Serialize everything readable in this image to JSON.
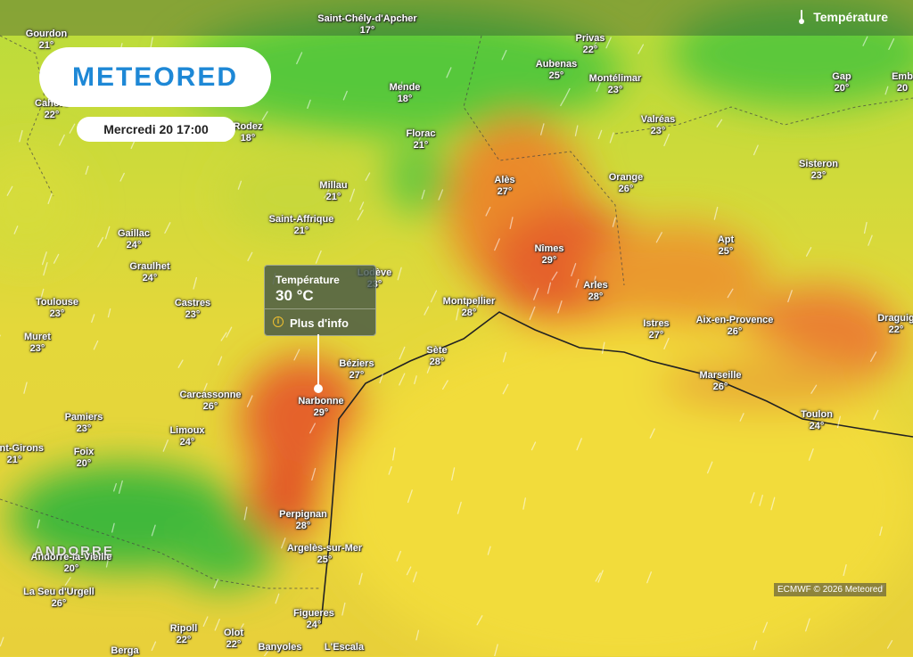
{
  "header": {
    "layer_label": "Température"
  },
  "brand": {
    "logo_text": "METEORED"
  },
  "forecast_time": "Mercredi 20 17:00",
  "popup": {
    "title": "Température",
    "value": "30 °C",
    "more_label": "Plus d'info"
  },
  "credit": "ECMWF © 2026 Meteored",
  "region_label": "ANDORRE",
  "colors": {
    "sea": "#f2dc3a",
    "hot": "#e8581e",
    "mild": "#d6e03a",
    "cool": "#3cc23a",
    "brand": "#1e88d6"
  },
  "cities": [
    {
      "name": "Gourdon",
      "temp": "21°"
    },
    {
      "name": "Saint-Chély-d'Apcher",
      "temp": "17°"
    },
    {
      "name": "Privas",
      "temp": "22°"
    },
    {
      "name": "Aubenas",
      "temp": "25°"
    },
    {
      "name": "Montélimar",
      "temp": "23°"
    },
    {
      "name": "Gap",
      "temp": "20°"
    },
    {
      "name": "Emb",
      "temp": "20"
    },
    {
      "name": "Mende",
      "temp": "18°"
    },
    {
      "name": "Cahors",
      "temp": "22°"
    },
    {
      "name": "Rodez",
      "temp": "18°"
    },
    {
      "name": "Florac",
      "temp": "21°"
    },
    {
      "name": "Valréas",
      "temp": "23°"
    },
    {
      "name": "Alès",
      "temp": "27°"
    },
    {
      "name": "Orange",
      "temp": "26°"
    },
    {
      "name": "Sisteron",
      "temp": "23°"
    },
    {
      "name": "Millau",
      "temp": "21°"
    },
    {
      "name": "Saint-Affrique",
      "temp": "21°"
    },
    {
      "name": "Gaillac",
      "temp": "24°"
    },
    {
      "name": "Nîmes",
      "temp": "29°"
    },
    {
      "name": "Apt",
      "temp": "25°"
    },
    {
      "name": "Graulhet",
      "temp": "24°"
    },
    {
      "name": "Lodève",
      "temp": "23°"
    },
    {
      "name": "Arles",
      "temp": "28°"
    },
    {
      "name": "Toulouse",
      "temp": "23°"
    },
    {
      "name": "Castres",
      "temp": "23°"
    },
    {
      "name": "Montpellier",
      "temp": "28°"
    },
    {
      "name": "Draguig",
      "temp": "22°"
    },
    {
      "name": "Istres",
      "temp": "27°"
    },
    {
      "name": "Aix-en-Provence",
      "temp": "26°"
    },
    {
      "name": "Muret",
      "temp": "23°"
    },
    {
      "name": "Sète",
      "temp": "28°"
    },
    {
      "name": "Béziers",
      "temp": "27°"
    },
    {
      "name": "Marseille",
      "temp": "26°"
    },
    {
      "name": "Carcassonne",
      "temp": "26°"
    },
    {
      "name": "Narbonne",
      "temp": "29°"
    },
    {
      "name": "Toulon",
      "temp": "24°"
    },
    {
      "name": "Pamiers",
      "temp": "23°"
    },
    {
      "name": "Limoux",
      "temp": "24°"
    },
    {
      "name": "Saint-Girons",
      "temp": "21°"
    },
    {
      "name": "Foix",
      "temp": "20°"
    },
    {
      "name": "Perpignan",
      "temp": "28°"
    },
    {
      "name": "Argelès-sur-Mer",
      "temp": "25°"
    },
    {
      "name": "Andorre-la-Vieille",
      "temp": "20°"
    },
    {
      "name": "La Seu d'Urgell",
      "temp": "26°"
    },
    {
      "name": "Figueres",
      "temp": "24°"
    },
    {
      "name": "Ripoll",
      "temp": "22°"
    },
    {
      "name": "Olot",
      "temp": "22°"
    },
    {
      "name": "Berga",
      "temp": ""
    },
    {
      "name": "Banyoles",
      "temp": ""
    },
    {
      "name": "L'Escala",
      "temp": ""
    }
  ]
}
